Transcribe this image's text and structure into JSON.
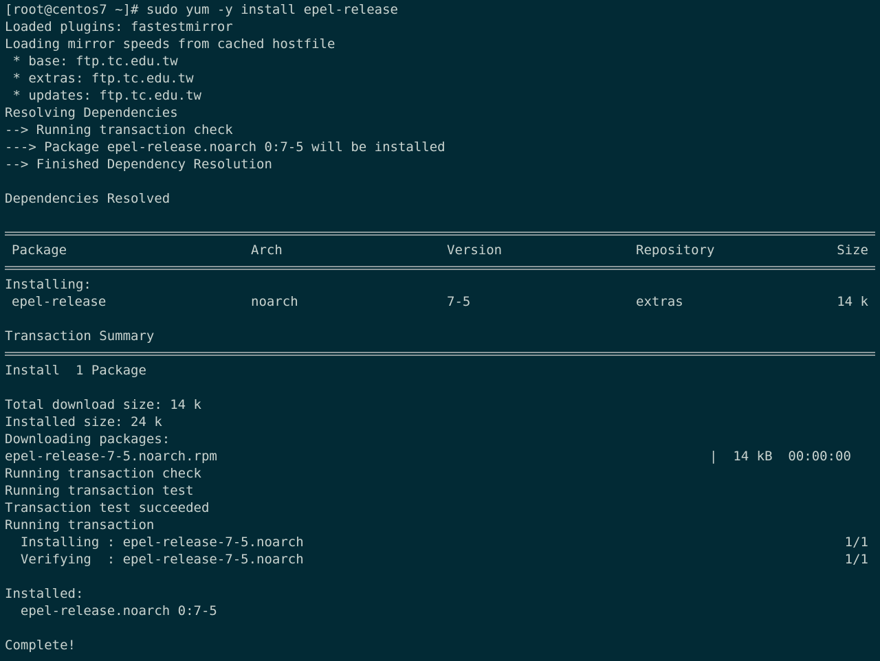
{
  "terminal": {
    "lines": {
      "l01": "[root@centos7 ~]# sudo yum -y install epel-release",
      "l02": "Loaded plugins: fastestmirror",
      "l03": "Loading mirror speeds from cached hostfile",
      "l04": " * base: ftp.tc.edu.tw",
      "l05": " * extras: ftp.tc.edu.tw",
      "l06": " * updates: ftp.tc.edu.tw",
      "l07": "Resolving Dependencies",
      "l08": "--> Running transaction check",
      "l09": "---> Package epel-release.noarch 0:7-5 will be installed",
      "l10": "--> Finished Dependency Resolution",
      "l12": "Dependencies Resolved",
      "l17": "Installing:",
      "l19": "Transaction Summary",
      "l21": "Install  1 Package",
      "l23": "Total download size: 14 k",
      "l24": "Installed size: 24 k",
      "l25": "Downloading packages:",
      "l27": "Running transaction check",
      "l28": "Running transaction test",
      "l29": "Transaction test succeeded",
      "l30": "Running transaction",
      "l34": "Installed:",
      "l35": "  epel-release.noarch 0:7-5",
      "l37": "Complete!"
    },
    "table": {
      "headers": {
        "package": "Package",
        "arch": "Arch",
        "version": "Version",
        "repository": "Repository",
        "size": "Size"
      },
      "row": {
        "package": "epel-release",
        "arch": "noarch",
        "version": "7-5",
        "repository": "extras",
        "size": "14 k"
      }
    },
    "download": {
      "file": "epel-release-7-5.noarch.rpm",
      "stats": "|  14 kB  00:00:00"
    },
    "steps": [
      {
        "label": "  Installing : epel-release-7-5.noarch",
        "progress": "1/1"
      },
      {
        "label": "  Verifying  : epel-release-7-5.noarch",
        "progress": "1/1"
      }
    ]
  }
}
